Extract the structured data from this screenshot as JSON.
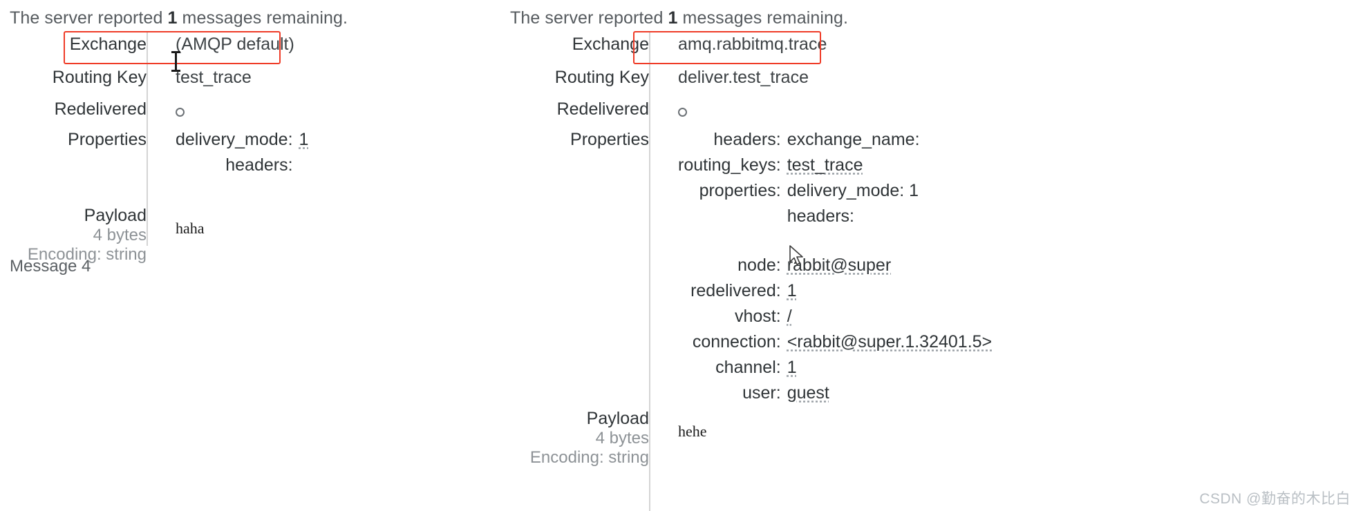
{
  "colors": {
    "highlight": "#ef3b27",
    "label": "#2f3437",
    "muted": "#8d9296",
    "divider": "#d4d4d4"
  },
  "left_panel": {
    "server_note_prefix": "The server reported ",
    "server_note_count": "1",
    "server_note_suffix": " messages remaining.",
    "rows": {
      "exchange_label": "Exchange",
      "exchange_value": "(AMQP default)",
      "routing_key_label": "Routing Key",
      "routing_key_value": "test_trace",
      "redelivered_label": "Redelivered",
      "redelivered_value": "○",
      "properties_label": "Properties",
      "properties": [
        {
          "key": "delivery_mode:",
          "value": "1",
          "underlined": true
        },
        {
          "key": "headers:",
          "value": "",
          "underlined": false
        }
      ],
      "payload_label": "Payload",
      "payload_size": "4 bytes",
      "payload_encoding": "Encoding: string",
      "payload_body": "haha"
    },
    "message_index": "Message 4"
  },
  "right_panel": {
    "server_note_prefix": "The server reported ",
    "server_note_count": "1",
    "server_note_suffix": " messages remaining.",
    "rows": {
      "exchange_label": "Exchange",
      "exchange_value": "amq.rabbitmq.trace",
      "routing_key_label": "Routing Key",
      "routing_key_value": "deliver.test_trace",
      "redelivered_label": "Redelivered",
      "redelivered_value": "○",
      "properties_label": "Properties",
      "properties": [
        {
          "key": "headers:",
          "value": "exchange_name:",
          "underlined": false,
          "is_nested_header": true
        },
        {
          "key": "routing_keys:",
          "value": "test_trace",
          "underlined": true
        },
        {
          "key": "properties:",
          "value": "delivery_mode: 1",
          "underlined": false
        },
        {
          "key": "",
          "value": "headers:",
          "underlined": false
        },
        {
          "key": "node:",
          "value": "rabbit@super",
          "underlined": true
        },
        {
          "key": "redelivered:",
          "value": "1",
          "underlined": true
        },
        {
          "key": "vhost:",
          "value": "/",
          "underlined": true
        },
        {
          "key": "connection:",
          "value": "<rabbit@super.1.32401.5>",
          "underlined": true
        },
        {
          "key": "channel:",
          "value": "1",
          "underlined": true
        },
        {
          "key": "user:",
          "value": "guest",
          "underlined": true
        }
      ],
      "payload_label": "Payload",
      "payload_size": "4 bytes",
      "payload_encoding": "Encoding: string",
      "payload_body": "hehe"
    }
  },
  "watermark": "CSDN @勤奋的木比白"
}
